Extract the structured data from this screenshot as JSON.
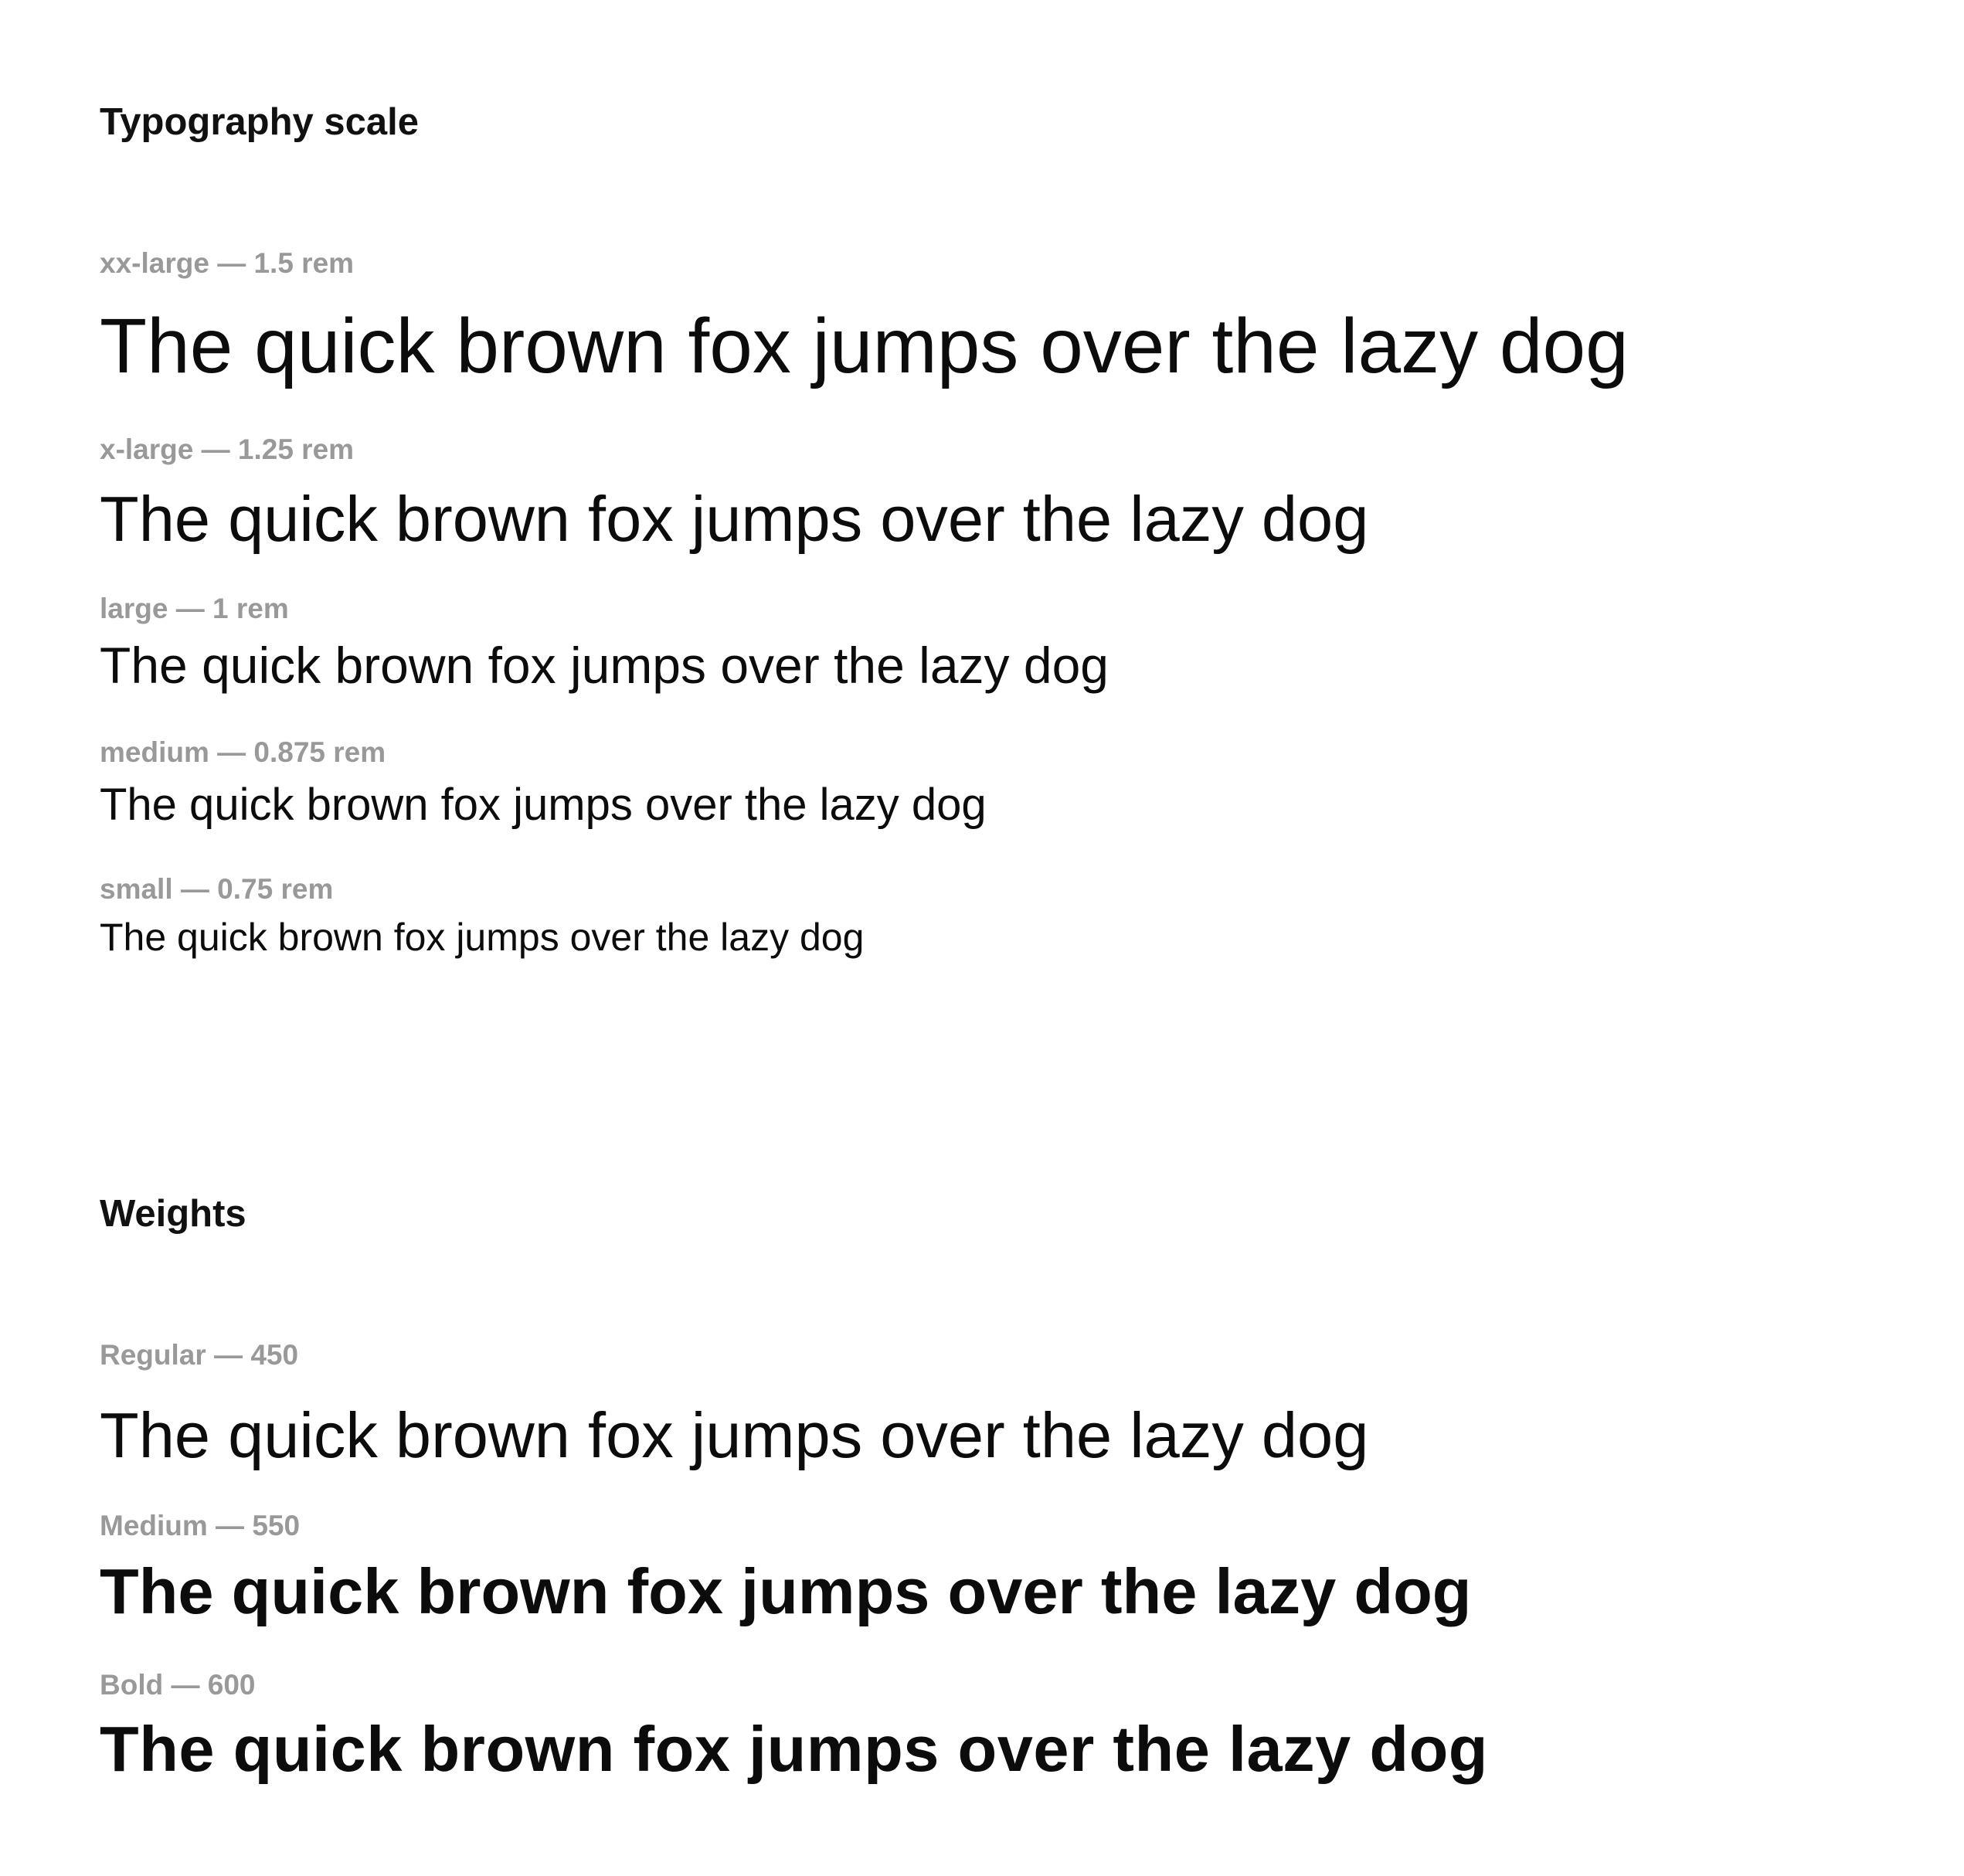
{
  "typography_scale": {
    "title": "Typography scale",
    "items": [
      {
        "label": "xx-large — 1.5 rem",
        "sample": "The quick brown fox jumps over the lazy dog"
      },
      {
        "label": "x-large — 1.25 rem",
        "sample": "The quick brown fox jumps over the lazy dog"
      },
      {
        "label": "large — 1 rem",
        "sample": "The quick brown fox jumps over the lazy dog"
      },
      {
        "label": "medium — 0.875 rem",
        "sample": "The quick brown fox jumps over the lazy dog"
      },
      {
        "label": "small — 0.75 rem",
        "sample": "The quick brown fox jumps over the lazy dog"
      }
    ]
  },
  "weights": {
    "title": "Weights",
    "items": [
      {
        "label": "Regular — 450",
        "sample": "The quick brown fox jumps over the lazy dog"
      },
      {
        "label": "Medium — 550",
        "sample": "The quick brown fox jumps over the lazy dog"
      },
      {
        "label": "Bold — 600",
        "sample": "The quick brown fox jumps over the lazy dog"
      }
    ]
  },
  "colors": {
    "text": "#111111",
    "label": "#999999",
    "background": "#ffffff"
  }
}
